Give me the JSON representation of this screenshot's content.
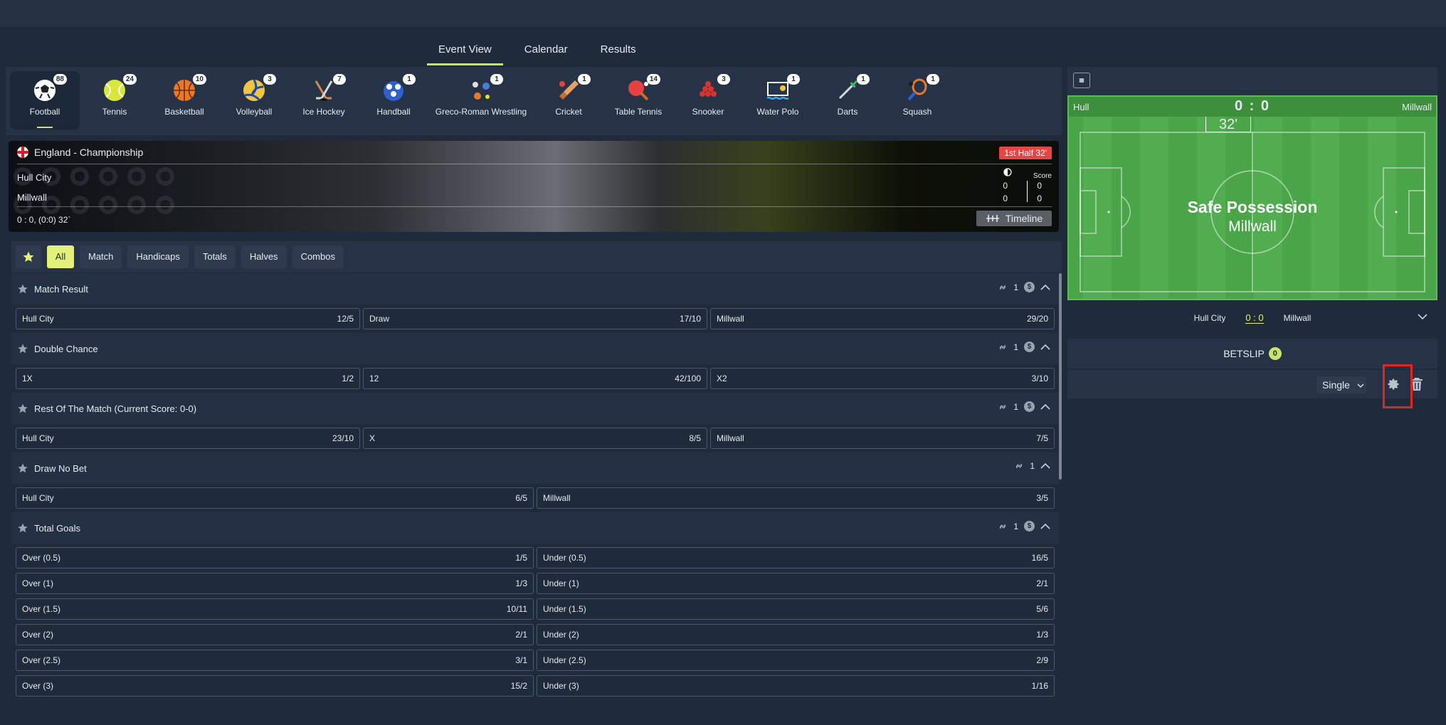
{
  "tabs": [
    {
      "label": "Event View"
    },
    {
      "label": "Calendar"
    },
    {
      "label": "Results"
    }
  ],
  "sports": [
    {
      "label": "Football",
      "count": "88",
      "icon": "football-icon"
    },
    {
      "label": "Tennis",
      "count": "24",
      "icon": "tennis-icon"
    },
    {
      "label": "Basketball",
      "count": "10",
      "icon": "basketball-icon"
    },
    {
      "label": "Volleyball",
      "count": "3",
      "icon": "volleyball-icon"
    },
    {
      "label": "Ice Hockey",
      "count": "7",
      "icon": "ice-hockey-icon"
    },
    {
      "label": "Handball",
      "count": "1",
      "icon": "handball-icon"
    },
    {
      "label": "Greco-Roman Wrestling",
      "count": "1",
      "icon": "wrestling-icon"
    },
    {
      "label": "Cricket",
      "count": "1",
      "icon": "cricket-icon"
    },
    {
      "label": "Table Tennis",
      "count": "14",
      "icon": "table-tennis-icon"
    },
    {
      "label": "Snooker",
      "count": "3",
      "icon": "snooker-icon"
    },
    {
      "label": "Water Polo",
      "count": "1",
      "icon": "water-polo-icon"
    },
    {
      "label": "Darts",
      "count": "1",
      "icon": "darts-icon"
    },
    {
      "label": "Squash",
      "count": "1",
      "icon": "squash-icon"
    }
  ],
  "scoreboard": {
    "league": "England - Championship",
    "status": "1st Half 32'",
    "home": "Hull City",
    "away": "Millwall",
    "score_header": "Score",
    "home_c": "0",
    "home_s": "0",
    "away_c": "0",
    "away_s": "0",
    "info": "0 : 0, (0:0) 32`",
    "timeline": "Timeline"
  },
  "filters": [
    {
      "label": "All"
    },
    {
      "label": "Match"
    },
    {
      "label": "Handicaps"
    },
    {
      "label": "Totals"
    },
    {
      "label": "Halves"
    },
    {
      "label": "Combos"
    }
  ],
  "markets": [
    {
      "title": "Match Result",
      "links": "1",
      "coin": true,
      "rows": [
        [
          [
            "Hull City",
            "12/5"
          ],
          [
            "Draw",
            "17/10"
          ],
          [
            "Millwall",
            "29/20"
          ]
        ]
      ]
    },
    {
      "title": "Double Chance",
      "links": "1",
      "coin": true,
      "rows": [
        [
          [
            "1X",
            "1/2"
          ],
          [
            "12",
            "42/100"
          ],
          [
            "X2",
            "3/10"
          ]
        ]
      ]
    },
    {
      "title": "Rest Of The Match (Current Score: 0-0)",
      "links": "1",
      "coin": true,
      "rows": [
        [
          [
            "Hull City",
            "23/10"
          ],
          [
            "X",
            "8/5"
          ],
          [
            "Millwall",
            "7/5"
          ]
        ]
      ]
    },
    {
      "title": "Draw No Bet",
      "links": "1",
      "coin": false,
      "rows": [
        [
          [
            "Hull City",
            "6/5"
          ],
          [
            "Millwall",
            "3/5"
          ]
        ]
      ]
    },
    {
      "title": "Total Goals",
      "links": "1",
      "coin": true,
      "rows": [
        [
          [
            "Over (0.5)",
            "1/5"
          ],
          [
            "Under (0.5)",
            "16/5"
          ]
        ],
        [
          [
            "Over (1)",
            "1/3"
          ],
          [
            "Under (1)",
            "2/1"
          ]
        ],
        [
          [
            "Over (1.5)",
            "10/11"
          ],
          [
            "Under (1.5)",
            "5/6"
          ]
        ],
        [
          [
            "Over (2)",
            "2/1"
          ],
          [
            "Under (2)",
            "1/3"
          ]
        ],
        [
          [
            "Over (2.5)",
            "3/1"
          ],
          [
            "Under (2.5)",
            "2/9"
          ]
        ],
        [
          [
            "Over (3)",
            "15/2"
          ],
          [
            "Under (3)",
            "1/16"
          ]
        ]
      ]
    }
  ],
  "pitch": {
    "home": "Hull",
    "away": "Millwall",
    "score": "0 : 0",
    "clock": "32'",
    "possession_title": "Safe Possession",
    "possession_team": "Millwall"
  },
  "summary": {
    "home": "Hull City",
    "score": "0 : 0",
    "away": "Millwall"
  },
  "betslip": {
    "title": "BETSLIP",
    "count": "0",
    "mode": "Single"
  },
  "colors": {
    "accent": "#c8e46a",
    "live": "#e54545",
    "pitch": "#4aa548",
    "highlight": "#e3251f"
  }
}
